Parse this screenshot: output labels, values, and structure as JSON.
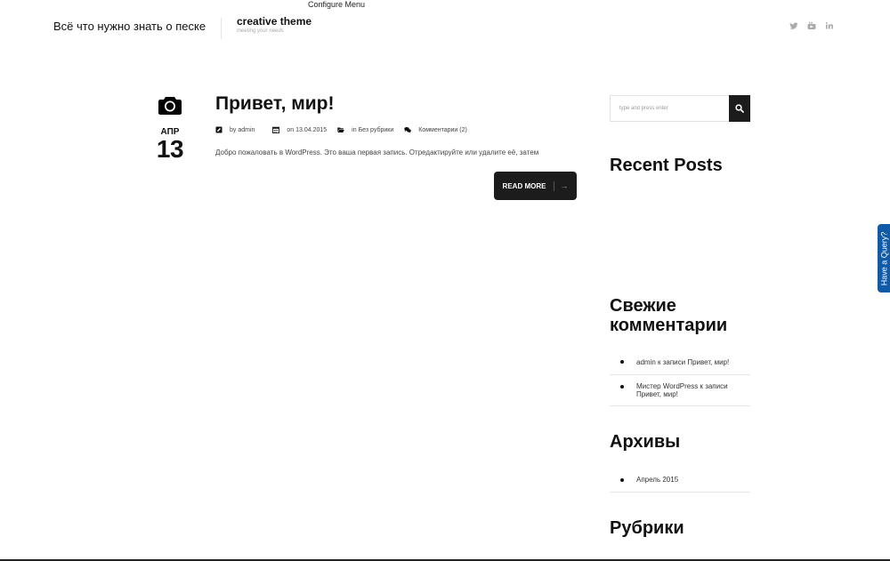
{
  "header": {
    "configure_menu": "Configure Menu",
    "site_name": "Всё что нужно знать о песке",
    "theme_title": "creative theme",
    "theme_tagline": "meeting your needs",
    "social_icons": [
      "twitter-icon",
      "youtube-icon",
      "linkedin-icon"
    ]
  },
  "post": {
    "month": "АПР",
    "day": "13",
    "title": "Привет, мир!",
    "author": "by admin",
    "date": "on 13.04.2015",
    "category": "in Без рубрики",
    "comments": "Комментарии (2)",
    "excerpt": "Добро пожаловать в WordPress. Это ваша первая запись. Отредактируйте или удалите её, затем",
    "read_more": "READ MORE",
    "read_more_arrow": "→"
  },
  "sidebar": {
    "search_placeholder": "type and press enter",
    "recent_posts_title": "Recent Posts",
    "comments_title": "Свежие комментарии",
    "comments": [
      "admin к записи Привет, мир!",
      "Мистер WordPress к записи Привет, мир!"
    ],
    "archives_title": "Архивы",
    "archives": [
      "Апрель 2015"
    ],
    "categories_title": "Рубрики"
  },
  "query_tab": "Have a Query?",
  "colors": {
    "text": "#111111",
    "button_bg": "#1c1c1c",
    "query_tab": "#0f5ba7"
  }
}
